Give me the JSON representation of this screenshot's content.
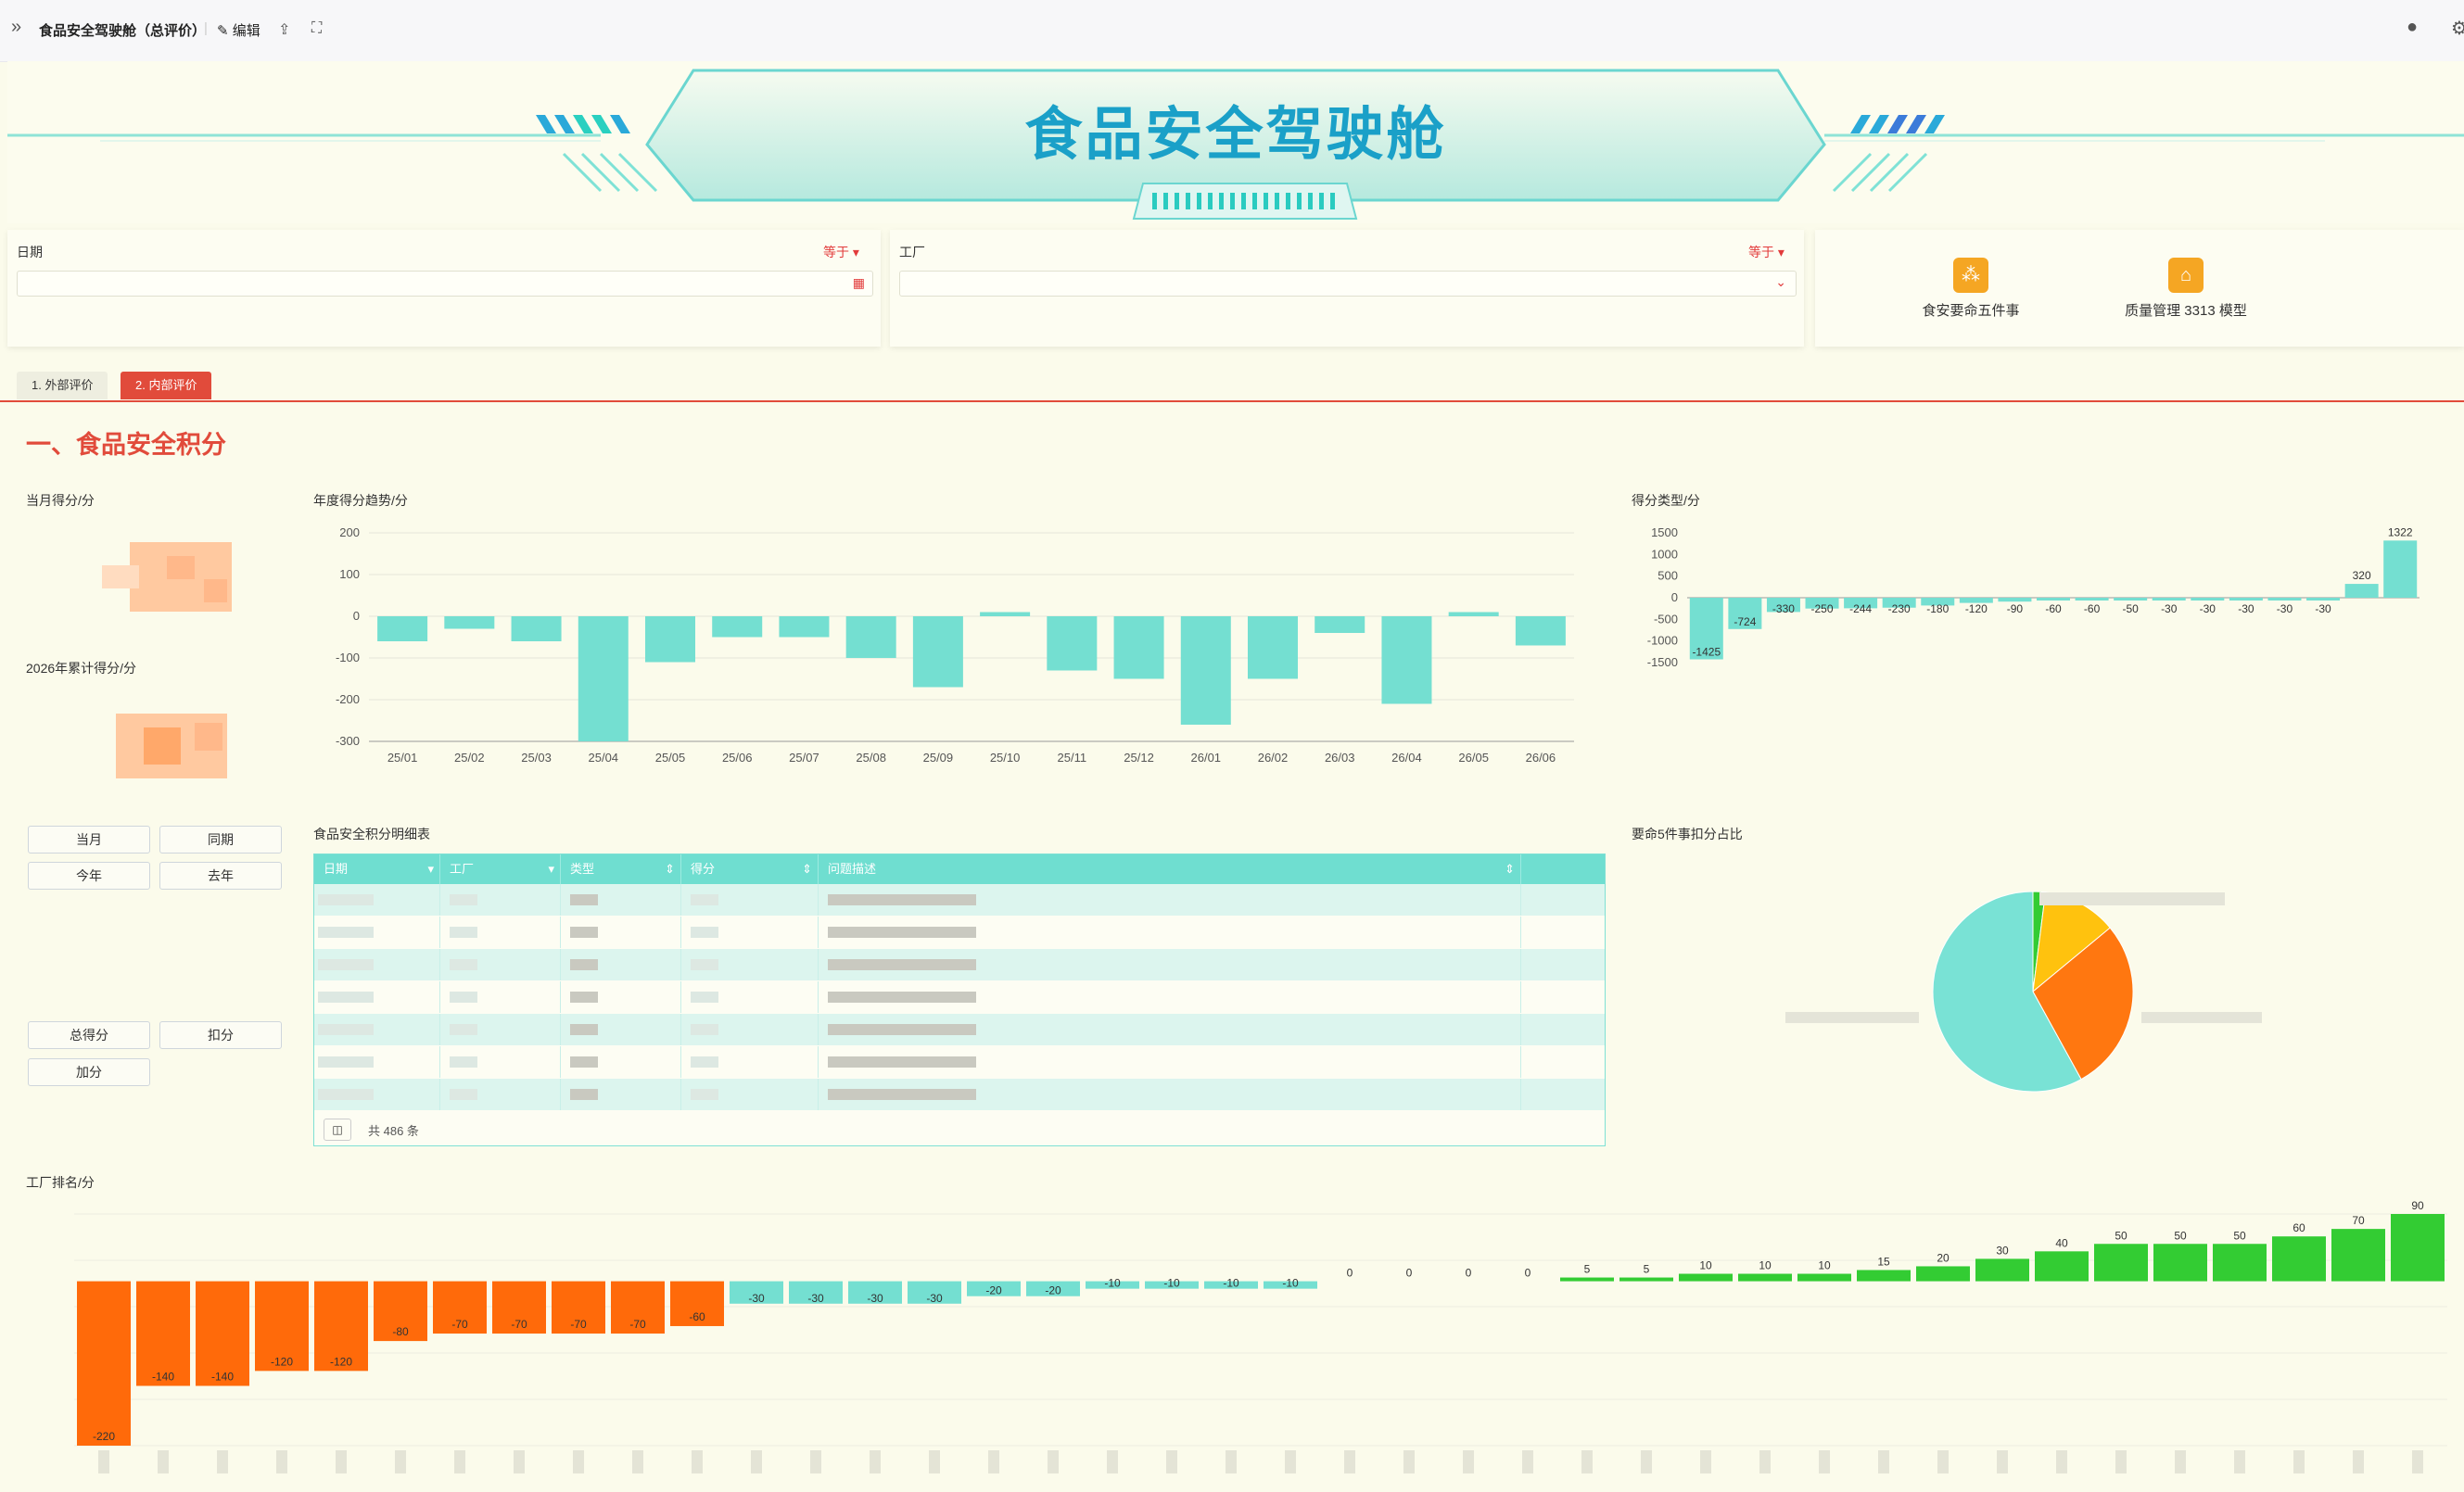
{
  "topbar": {
    "title": "食品安全驾驶舱（总评价）",
    "edit_label": "编辑"
  },
  "banner": {
    "title": "食品安全驾驶舱"
  },
  "filters": {
    "date_label": "日期",
    "date_op": "等于",
    "factory_label": "工厂",
    "factory_op": "等于"
  },
  "quicklinks": [
    {
      "label": "食安要命五件事",
      "icon": "sitemap-icon"
    },
    {
      "label": "质量管理 3313 模型",
      "icon": "home-icon"
    }
  ],
  "tabs": [
    {
      "label": "1. 外部评价",
      "active": false
    },
    {
      "label": "2. 内部评价",
      "active": true
    }
  ],
  "section": {
    "title": "一、食品安全积分"
  },
  "panels": {
    "monthly_score": "当月得分/分",
    "cumulative_score": "2026年累计得分/分",
    "annual_trend": "年度得分趋势/分",
    "score_types": "得分类型/分",
    "detail_table": "食品安全积分明细表",
    "pie_title": "要命5件事扣分占比",
    "factory_rank": "工厂排名/分"
  },
  "period_buttons": [
    "当月",
    "同期",
    "今年",
    "去年"
  ],
  "score_buttons": [
    "总得分",
    "扣分",
    "加分"
  ],
  "table": {
    "columns": [
      "日期",
      "工厂",
      "类型",
      "得分",
      "问题描述"
    ],
    "total_text": "共 486 条"
  },
  "colors": {
    "accent": "#e14b3b",
    "teal": "#6fded0",
    "orange": "#ff6a0a",
    "green": "#33cc33",
    "yellow": "#ffc20e"
  },
  "chart_data": [
    {
      "type": "bar",
      "categories": [
        "25/01",
        "25/02",
        "25/03",
        "25/04",
        "25/05",
        "25/06",
        "25/07",
        "25/08",
        "25/09",
        "25/10",
        "25/11",
        "25/12",
        "26/01",
        "26/02",
        "26/03",
        "26/04",
        "26/05",
        "26/06"
      ],
      "values": [
        -60,
        -30,
        -60,
        -300,
        -110,
        -50,
        -50,
        -100,
        -170,
        10,
        -130,
        -150,
        -260,
        -150,
        -40,
        -210,
        10,
        -70
      ],
      "ylim": [
        -300,
        200
      ],
      "yticks": [
        200,
        100,
        0,
        -100,
        -200,
        -300
      ]
    },
    {
      "type": "bar",
      "values": [
        -1425,
        -724,
        -330,
        -250,
        -244,
        -230,
        -180,
        -120,
        -90,
        -60,
        -60,
        -50,
        -30,
        -30,
        -30,
        -30,
        -30,
        320,
        1322
      ],
      "ylim": [
        -1500,
        1500
      ],
      "yticks": [
        1500,
        1000,
        500,
        0,
        -500,
        -1000,
        -1500
      ]
    },
    {
      "type": "pie",
      "values": [
        58,
        28,
        12,
        2
      ],
      "colors": [
        "#79e2d5",
        "#ff7710",
        "#ffc20e",
        "#33cc33"
      ]
    },
    {
      "type": "bar",
      "values": [
        -220,
        -140,
        -140,
        -120,
        -120,
        -80,
        -70,
        -70,
        -70,
        -70,
        -60,
        -30,
        -30,
        -30,
        -30,
        -20,
        -20,
        -10,
        -10,
        -10,
        -10,
        0,
        0,
        0,
        0,
        5,
        5,
        10,
        10,
        10,
        15,
        20,
        30,
        40,
        50,
        50,
        50,
        60,
        70,
        90
      ],
      "ylim": [
        -220,
        90
      ]
    }
  ]
}
